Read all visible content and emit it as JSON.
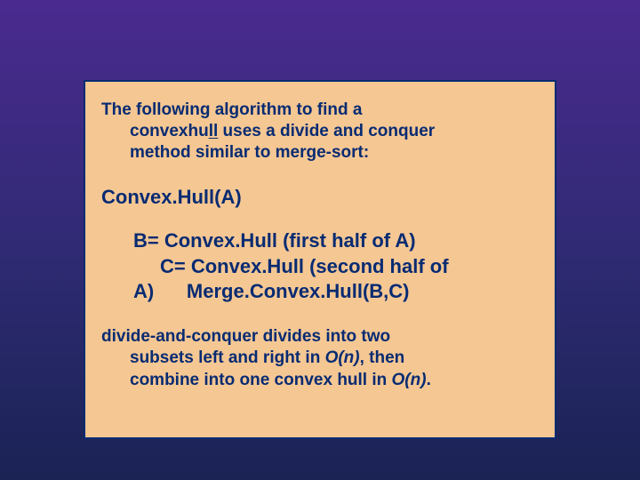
{
  "intro": {
    "line1": "The following algorithm to find a",
    "line2a": "convexhu",
    "line2b": "ll",
    "line2c": " uses a divide and conquer",
    "line3": "method similar to merge-sort:"
  },
  "fn_title": "Convex.Hull(A)",
  "code": {
    "l1": "B= Convex.Hull (first half of A)",
    "l2": "C= Convex.Hull (second half of",
    "l3a": "A)",
    "l3b": "Merge.Convex.Hull(B,C)"
  },
  "outro": {
    "l1": "divide-and-conquer divides into two",
    "l2a": "subsets left and right in ",
    "l2b": "O(n)",
    "l2c": ", then",
    "l3a": "combine into one convex hull in ",
    "l3b": "O(n)",
    "l3c": "."
  }
}
